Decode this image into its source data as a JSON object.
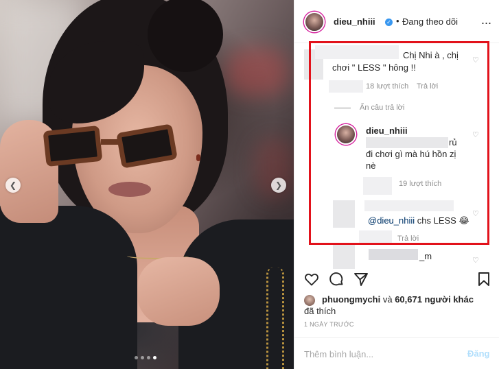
{
  "post": {
    "author": "dieu_nhiii",
    "separator": "•",
    "follow_status": "Đang theo dõi",
    "more_symbol": "...",
    "carousel_dots": 4,
    "carousel_active_index": 3
  },
  "comments": {
    "first": {
      "text_line1": "Chị Nhi à , chị",
      "text_line2": "chơi \" LESS \" hông !!",
      "likes": "18 lượt thích",
      "reply": "Trả lời"
    },
    "hide_replies": "Ẩn câu trả lời",
    "reply1": {
      "author": "dieu_nhiii",
      "mention_tail": "rủ",
      "text_line2": "đi chơi gì mà hú hồn zị",
      "text_line3": "nè",
      "likes": "19 lượt thích"
    },
    "reply2": {
      "mention": "@dieu_nhiii",
      "text": " chs LESS 😂",
      "reply": "Trả lời"
    },
    "reply3": {
      "author_tail": "_m"
    }
  },
  "likes_summary": {
    "user": "phuongmychi",
    "connector": " và ",
    "count": "60,671 người khác",
    "suffix": "đã thích"
  },
  "date": "1 NGÀY TRƯỚC",
  "composer": {
    "placeholder": "Thêm bình luận...",
    "post_label": "Đăng"
  },
  "colors": {
    "highlight_border": "#e2121b",
    "verified_badge": "#3897f0",
    "post_button_disabled": "#b2dffc",
    "mention": "#003569"
  }
}
